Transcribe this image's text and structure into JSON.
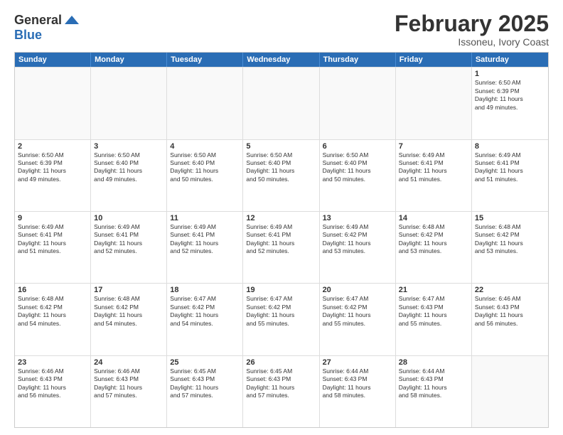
{
  "logo": {
    "general": "General",
    "blue": "Blue"
  },
  "title": "February 2025",
  "subtitle": "Issoneu, Ivory Coast",
  "headers": [
    "Sunday",
    "Monday",
    "Tuesday",
    "Wednesday",
    "Thursday",
    "Friday",
    "Saturday"
  ],
  "weeks": [
    [
      {
        "day": "",
        "info": ""
      },
      {
        "day": "",
        "info": ""
      },
      {
        "day": "",
        "info": ""
      },
      {
        "day": "",
        "info": ""
      },
      {
        "day": "",
        "info": ""
      },
      {
        "day": "",
        "info": ""
      },
      {
        "day": "1",
        "info": "Sunrise: 6:50 AM\nSunset: 6:39 PM\nDaylight: 11 hours\nand 49 minutes."
      }
    ],
    [
      {
        "day": "2",
        "info": "Sunrise: 6:50 AM\nSunset: 6:39 PM\nDaylight: 11 hours\nand 49 minutes."
      },
      {
        "day": "3",
        "info": "Sunrise: 6:50 AM\nSunset: 6:40 PM\nDaylight: 11 hours\nand 49 minutes."
      },
      {
        "day": "4",
        "info": "Sunrise: 6:50 AM\nSunset: 6:40 PM\nDaylight: 11 hours\nand 50 minutes."
      },
      {
        "day": "5",
        "info": "Sunrise: 6:50 AM\nSunset: 6:40 PM\nDaylight: 11 hours\nand 50 minutes."
      },
      {
        "day": "6",
        "info": "Sunrise: 6:50 AM\nSunset: 6:40 PM\nDaylight: 11 hours\nand 50 minutes."
      },
      {
        "day": "7",
        "info": "Sunrise: 6:49 AM\nSunset: 6:41 PM\nDaylight: 11 hours\nand 51 minutes."
      },
      {
        "day": "8",
        "info": "Sunrise: 6:49 AM\nSunset: 6:41 PM\nDaylight: 11 hours\nand 51 minutes."
      }
    ],
    [
      {
        "day": "9",
        "info": "Sunrise: 6:49 AM\nSunset: 6:41 PM\nDaylight: 11 hours\nand 51 minutes."
      },
      {
        "day": "10",
        "info": "Sunrise: 6:49 AM\nSunset: 6:41 PM\nDaylight: 11 hours\nand 52 minutes."
      },
      {
        "day": "11",
        "info": "Sunrise: 6:49 AM\nSunset: 6:41 PM\nDaylight: 11 hours\nand 52 minutes."
      },
      {
        "day": "12",
        "info": "Sunrise: 6:49 AM\nSunset: 6:41 PM\nDaylight: 11 hours\nand 52 minutes."
      },
      {
        "day": "13",
        "info": "Sunrise: 6:49 AM\nSunset: 6:42 PM\nDaylight: 11 hours\nand 53 minutes."
      },
      {
        "day": "14",
        "info": "Sunrise: 6:48 AM\nSunset: 6:42 PM\nDaylight: 11 hours\nand 53 minutes."
      },
      {
        "day": "15",
        "info": "Sunrise: 6:48 AM\nSunset: 6:42 PM\nDaylight: 11 hours\nand 53 minutes."
      }
    ],
    [
      {
        "day": "16",
        "info": "Sunrise: 6:48 AM\nSunset: 6:42 PM\nDaylight: 11 hours\nand 54 minutes."
      },
      {
        "day": "17",
        "info": "Sunrise: 6:48 AM\nSunset: 6:42 PM\nDaylight: 11 hours\nand 54 minutes."
      },
      {
        "day": "18",
        "info": "Sunrise: 6:47 AM\nSunset: 6:42 PM\nDaylight: 11 hours\nand 54 minutes."
      },
      {
        "day": "19",
        "info": "Sunrise: 6:47 AM\nSunset: 6:42 PM\nDaylight: 11 hours\nand 55 minutes."
      },
      {
        "day": "20",
        "info": "Sunrise: 6:47 AM\nSunset: 6:42 PM\nDaylight: 11 hours\nand 55 minutes."
      },
      {
        "day": "21",
        "info": "Sunrise: 6:47 AM\nSunset: 6:43 PM\nDaylight: 11 hours\nand 55 minutes."
      },
      {
        "day": "22",
        "info": "Sunrise: 6:46 AM\nSunset: 6:43 PM\nDaylight: 11 hours\nand 56 minutes."
      }
    ],
    [
      {
        "day": "23",
        "info": "Sunrise: 6:46 AM\nSunset: 6:43 PM\nDaylight: 11 hours\nand 56 minutes."
      },
      {
        "day": "24",
        "info": "Sunrise: 6:46 AM\nSunset: 6:43 PM\nDaylight: 11 hours\nand 57 minutes."
      },
      {
        "day": "25",
        "info": "Sunrise: 6:45 AM\nSunset: 6:43 PM\nDaylight: 11 hours\nand 57 minutes."
      },
      {
        "day": "26",
        "info": "Sunrise: 6:45 AM\nSunset: 6:43 PM\nDaylight: 11 hours\nand 57 minutes."
      },
      {
        "day": "27",
        "info": "Sunrise: 6:44 AM\nSunset: 6:43 PM\nDaylight: 11 hours\nand 58 minutes."
      },
      {
        "day": "28",
        "info": "Sunrise: 6:44 AM\nSunset: 6:43 PM\nDaylight: 11 hours\nand 58 minutes."
      },
      {
        "day": "",
        "info": ""
      }
    ]
  ]
}
